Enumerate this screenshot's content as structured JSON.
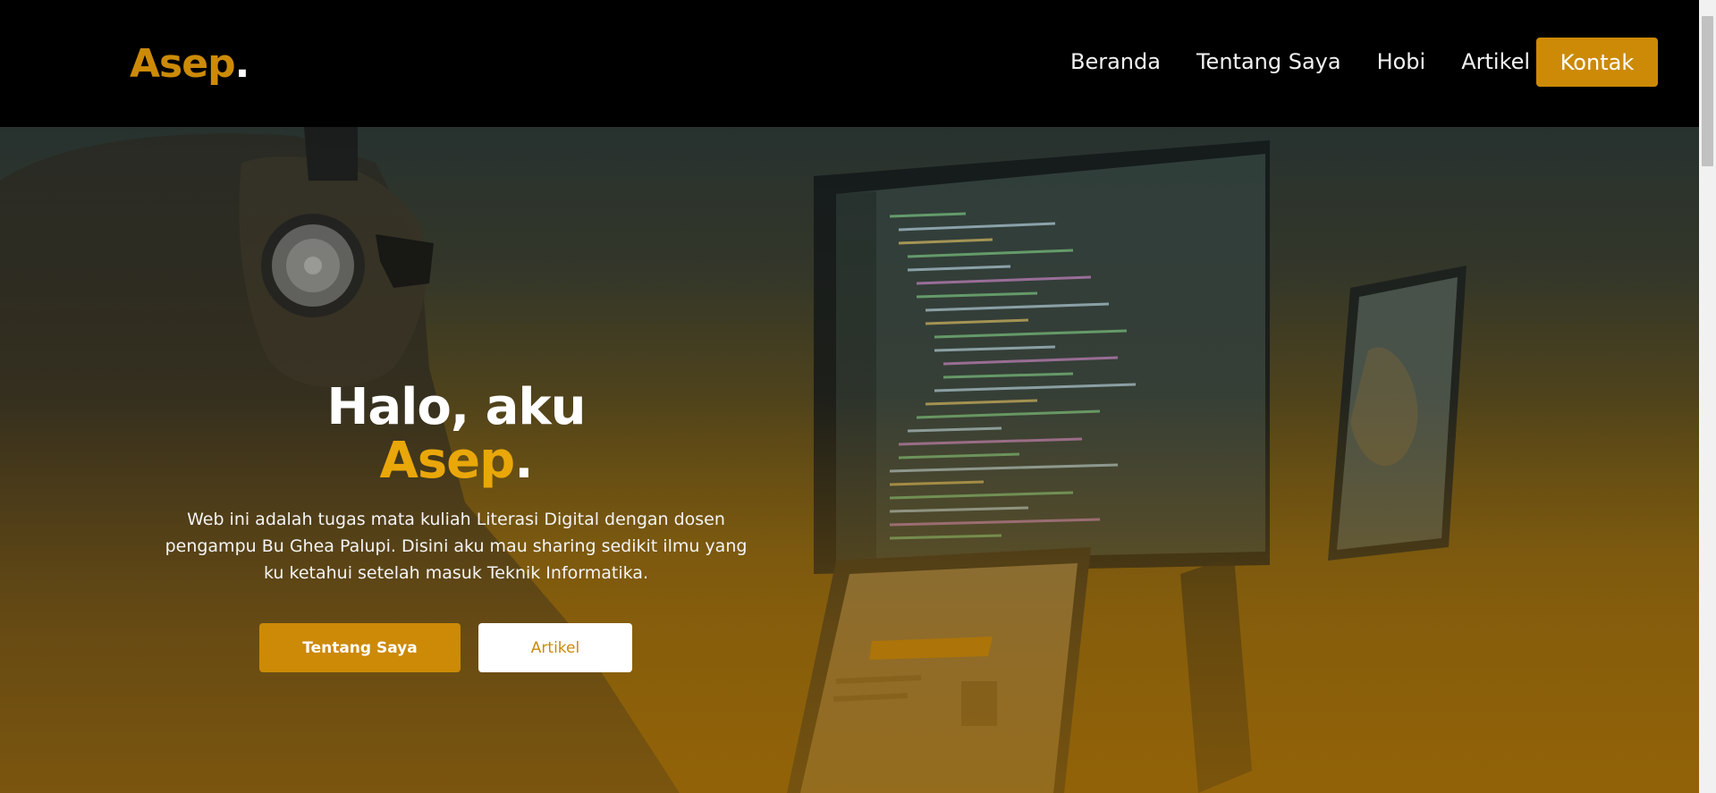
{
  "brand": {
    "name": "Asep",
    "dot": "."
  },
  "nav": {
    "links": [
      "Beranda",
      "Tentang Saya",
      "Hobi",
      "Artikel"
    ],
    "cta": "Kontak"
  },
  "hero": {
    "title_line1": "Halo, aku",
    "title_name": "Asep",
    "title_dot": ".",
    "description": "Web ini adalah tugas mata kuliah Literasi Digital dengan dosen pengampu Bu Ghea Palupi. Disini aku mau sharing sedikit ilmu yang ku ketahui setelah masuk Teknik Informatika.",
    "btn_primary": "Tentang Saya",
    "btn_secondary": "Artikel"
  },
  "colors": {
    "accent": "#cc8a07",
    "accent_text": "#e9a70a",
    "header_bg": "#000000"
  },
  "icons": [
    "headphones-photo",
    "monitor-photo",
    "laptop-photo"
  ]
}
